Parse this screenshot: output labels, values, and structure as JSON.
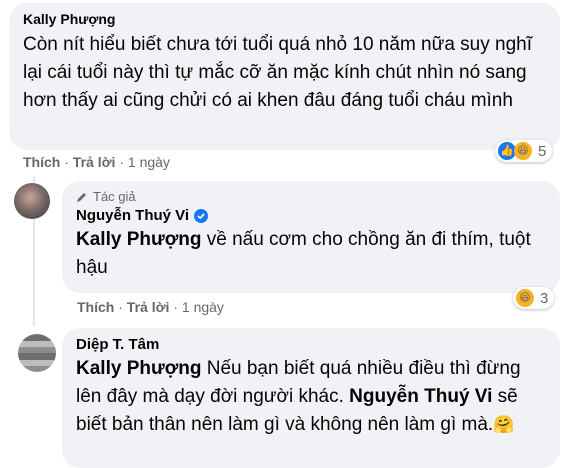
{
  "comments": [
    {
      "author": "Kally Phượng",
      "text": "Còn nít hiểu biết chưa tới tuổi quá nhỏ 10 năm nữa suy nghĩ lại cái tuổi này thì tự mắc cỡ ăn mặc kính chút nhìn nó sang hơn thấy ai cũng chửi có ai khen đâu đáng tuổi cháu mình",
      "like": "Thích",
      "reply": "Trả lời",
      "time": "1 ngày",
      "reaction_count": "5"
    },
    {
      "badge": "Tác giả",
      "author": "Nguyễn Thuý Vi",
      "mention": "Kally Phượng",
      "text": " về nấu cơm cho chồng ăn đi thím, tuột hậu",
      "like": "Thích",
      "reply": "Trả lời",
      "time": "1 ngày",
      "reaction_count": "3"
    },
    {
      "author": "Diệp T. Tâm",
      "mention1": "Kally Phượng",
      "text1": " Nếu bạn biết quá nhiều điều thì đừng lên đây mà dạy đời người khác. ",
      "mention2": "Nguyễn Thuý Vi",
      "text2": " sẽ biết bản thân nên làm gì và không nên làm gì mà.",
      "emoji": "🤗"
    }
  ],
  "separator": "·",
  "colors": {
    "bubble": "#f0f2f5",
    "meta": "#65676b",
    "verified": "#1877f2",
    "like": "#1877f2",
    "haha": "#f7b125"
  }
}
